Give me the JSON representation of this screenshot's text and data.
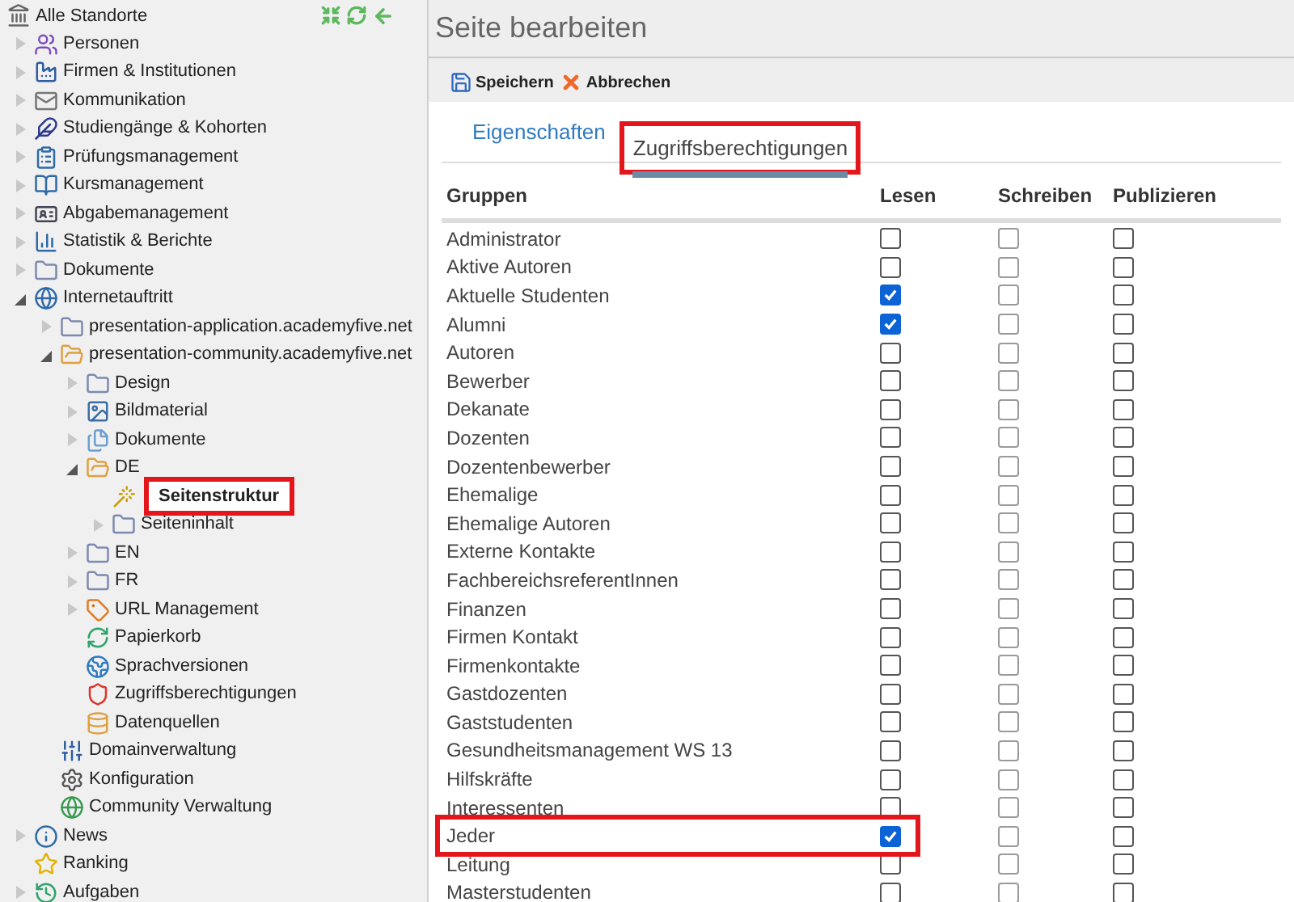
{
  "sidebar": {
    "root": {
      "label": "Alle Standorte",
      "selected": false
    },
    "tree": [
      {
        "label": "Personen",
        "expanded": false,
        "selected": false
      },
      {
        "label": "Firmen & Institutionen",
        "expanded": false,
        "selected": false
      },
      {
        "label": "Kommunikation",
        "expanded": false,
        "selected": false
      },
      {
        "label": "Studiengänge & Kohorten",
        "expanded": false,
        "selected": false
      },
      {
        "label": "Prüfungsmanagement",
        "expanded": false,
        "selected": false
      },
      {
        "label": "Kursmanagement",
        "expanded": false,
        "selected": false
      },
      {
        "label": "Abgabemanagement",
        "expanded": false,
        "selected": false
      },
      {
        "label": "Statistik & Berichte",
        "expanded": false,
        "selected": false
      },
      {
        "label": "Dokumente",
        "expanded": false,
        "selected": false
      },
      {
        "label": "Internetauftritt",
        "expanded": true,
        "selected": false,
        "children": [
          {
            "label": "presentation-application.academyfive.net",
            "expanded": false,
            "selected": false
          },
          {
            "label": "presentation-community.academyfive.net",
            "expanded": true,
            "selected": false,
            "children": [
              {
                "label": "Design",
                "expanded": false,
                "selected": false
              },
              {
                "label": "Bildmaterial",
                "expanded": false,
                "selected": false
              },
              {
                "label": "Dokumente",
                "expanded": false,
                "selected": false
              },
              {
                "label": "DE",
                "expanded": true,
                "selected": false,
                "children": [
                  {
                    "label": "Seitenstruktur",
                    "selected": true
                  },
                  {
                    "label": "Seiteninhalt",
                    "expanded": false,
                    "selected": false
                  }
                ]
              },
              {
                "label": "EN",
                "expanded": false,
                "selected": false
              },
              {
                "label": "FR",
                "expanded": false,
                "selected": false
              },
              {
                "label": "URL Management",
                "expanded": false,
                "selected": false
              },
              {
                "label": "Papierkorb",
                "selected": false
              },
              {
                "label": "Sprachversionen",
                "selected": false
              },
              {
                "label": "Zugriffsberechtigungen",
                "selected": false
              },
              {
                "label": "Datenquellen",
                "selected": false
              }
            ]
          },
          {
            "label": "Domainverwaltung",
            "selected": false
          },
          {
            "label": "Konfiguration",
            "selected": false
          },
          {
            "label": "Community Verwaltung",
            "selected": false
          }
        ]
      },
      {
        "label": "News",
        "expanded": false,
        "selected": false
      },
      {
        "label": "Ranking",
        "selected": false
      },
      {
        "label": "Aufgaben",
        "expanded": false,
        "selected": false
      }
    ]
  },
  "page": {
    "title": "Seite bearbeiten",
    "toolbar": [
      {
        "label": "Speichern",
        "kind": "save"
      },
      {
        "label": "Abbrechen",
        "kind": "cancel"
      }
    ],
    "tabs": [
      {
        "label": "Eigenschaften",
        "selected": false
      },
      {
        "label": "Zugriffsberechtigungen",
        "selected": true
      }
    ],
    "table": {
      "columns": [
        "Gruppen",
        "Lesen",
        "Schreiben",
        "Publizieren"
      ],
      "rows": [
        {
          "name": "Administrator",
          "read": false,
          "write": false,
          "publish": false,
          "highlighted": false
        },
        {
          "name": "Aktive Autoren",
          "read": false,
          "write": false,
          "publish": false,
          "highlighted": false
        },
        {
          "name": "Aktuelle Studenten",
          "read": true,
          "write": false,
          "publish": false,
          "highlighted": false
        },
        {
          "name": "Alumni",
          "read": true,
          "write": false,
          "publish": false,
          "highlighted": false
        },
        {
          "name": "Autoren",
          "read": false,
          "write": false,
          "publish": false,
          "highlighted": false
        },
        {
          "name": "Bewerber",
          "read": false,
          "write": false,
          "publish": false,
          "highlighted": false
        },
        {
          "name": "Dekanate",
          "read": false,
          "write": false,
          "publish": false,
          "highlighted": false
        },
        {
          "name": "Dozenten",
          "read": false,
          "write": false,
          "publish": false,
          "highlighted": false
        },
        {
          "name": "Dozentenbewerber",
          "read": false,
          "write": false,
          "publish": false,
          "highlighted": false
        },
        {
          "name": "Ehemalige",
          "read": false,
          "write": false,
          "publish": false,
          "highlighted": false
        },
        {
          "name": "Ehemalige Autoren",
          "read": false,
          "write": false,
          "publish": false,
          "highlighted": false
        },
        {
          "name": "Externe Kontakte",
          "read": false,
          "write": false,
          "publish": false,
          "highlighted": false
        },
        {
          "name": "FachbereichsreferentInnen",
          "read": false,
          "write": false,
          "publish": false,
          "highlighted": false
        },
        {
          "name": "Finanzen",
          "read": false,
          "write": false,
          "publish": false,
          "highlighted": false
        },
        {
          "name": "Firmen Kontakt",
          "read": false,
          "write": false,
          "publish": false,
          "highlighted": false
        },
        {
          "name": "Firmenkontakte",
          "read": false,
          "write": false,
          "publish": false,
          "highlighted": false
        },
        {
          "name": "Gastdozenten",
          "read": false,
          "write": false,
          "publish": false,
          "highlighted": false
        },
        {
          "name": "Gaststudenten",
          "read": false,
          "write": false,
          "publish": false,
          "highlighted": false
        },
        {
          "name": "Gesundheitsmanagement WS 13",
          "read": false,
          "write": false,
          "publish": false,
          "highlighted": false
        },
        {
          "name": "Hilfskräfte",
          "read": false,
          "write": false,
          "publish": false,
          "highlighted": false
        },
        {
          "name": "Interessenten",
          "read": false,
          "write": false,
          "publish": false,
          "highlighted": false
        },
        {
          "name": "Jeder",
          "read": true,
          "write": false,
          "publish": false,
          "highlighted": true
        },
        {
          "name": "Leitung",
          "read": false,
          "write": false,
          "publish": false,
          "highlighted": false
        },
        {
          "name": "Masterstudenten",
          "read": false,
          "write": false,
          "publish": false,
          "highlighted": false
        }
      ]
    }
  }
}
